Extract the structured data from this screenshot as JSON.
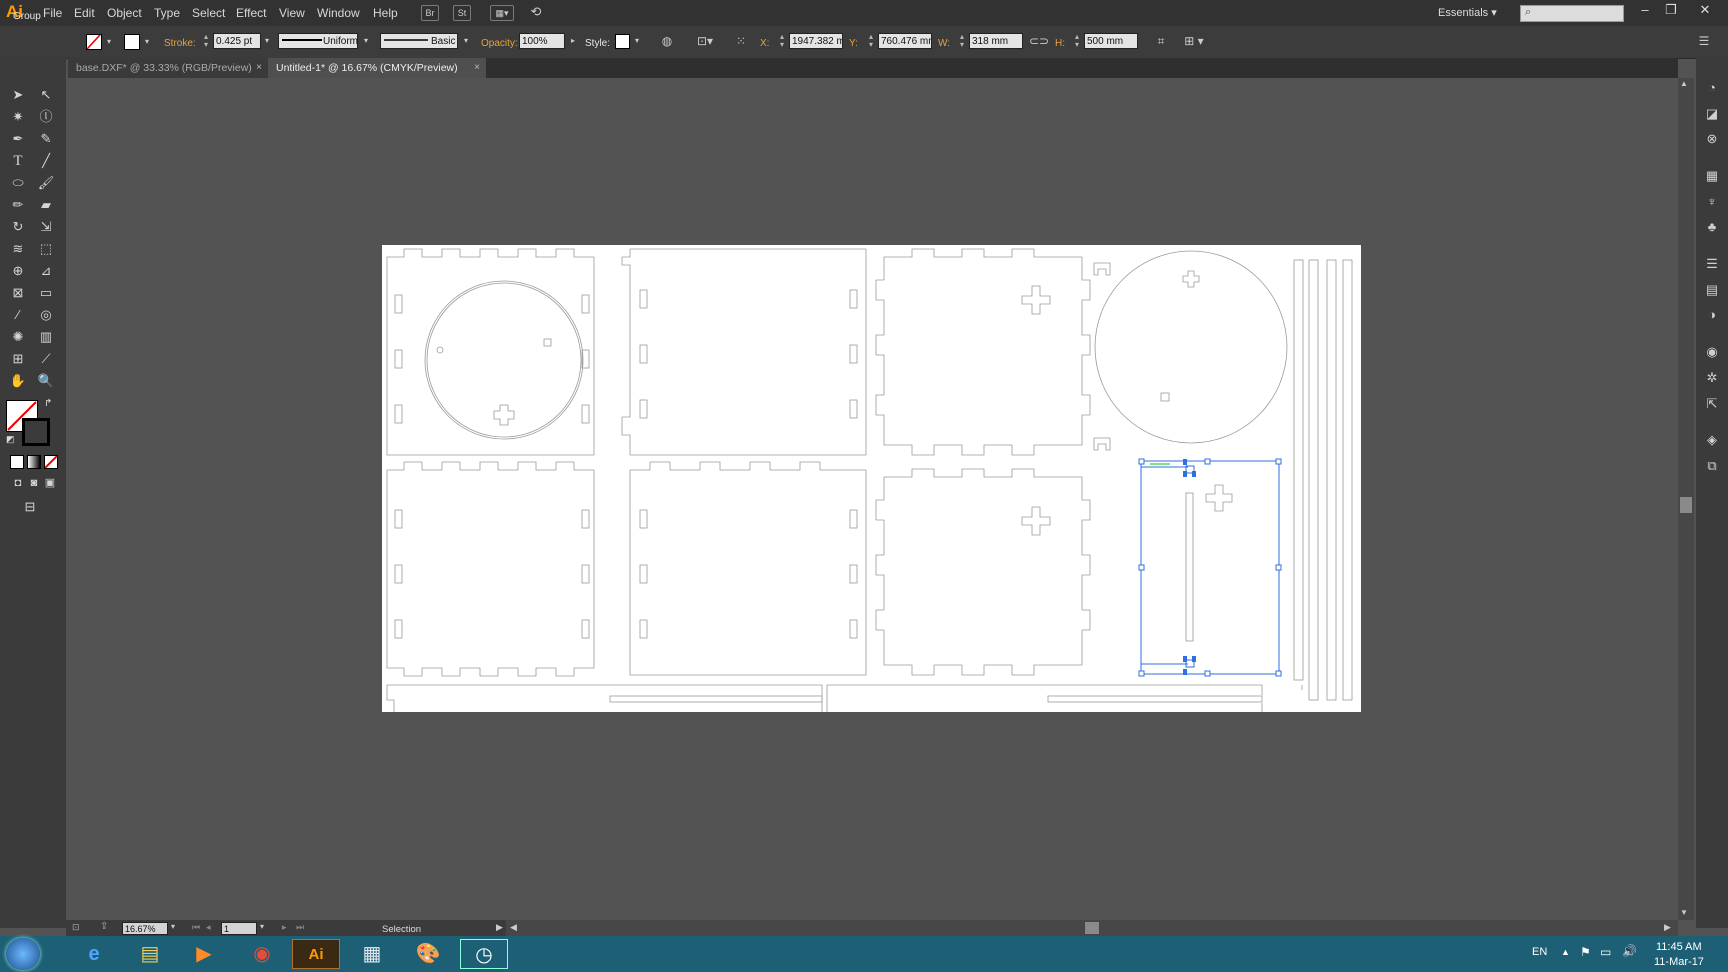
{
  "app": {
    "logo": "Ai"
  },
  "menu": [
    "File",
    "Edit",
    "Object",
    "Type",
    "Select",
    "Effect",
    "View",
    "Window",
    "Help"
  ],
  "menubar_icons": {
    "bridge": "Br",
    "stock": "St",
    "arrange": "arrange-documents-icon",
    "sync": "sync-icon"
  },
  "workspace": "Essentials",
  "control": {
    "selection_label": "Group",
    "stroke_label": "Stroke:",
    "stroke_weight": "0.425 pt",
    "profile": "Uniform",
    "brush": "Basic",
    "opacity_label": "Opacity:",
    "opacity": "100%",
    "style_label": "Style:",
    "x_label": "X:",
    "x_value": "1947.382 mi",
    "y_label": "Y:",
    "y_value": "760.476 mm",
    "w_label": "W:",
    "w_value": "318 mm",
    "h_label": "H:",
    "h_value": "500 mm"
  },
  "tabs": [
    {
      "label": "base.DXF* @ 33.33% (RGB/Preview)",
      "close": "×"
    },
    {
      "label": "Untitled-1* @ 16.67% (CMYK/Preview)",
      "close": "×"
    }
  ],
  "status": {
    "zoom": "16.67%",
    "artboard": "1",
    "tool": "Selection"
  },
  "taskbar": {
    "lang": "EN",
    "time": "11:45 AM",
    "date": "11-Mar-17"
  },
  "colors": {
    "accent": "#ff9a00",
    "selection": "#2f6fe0",
    "taskbar": "#1d5f75"
  }
}
